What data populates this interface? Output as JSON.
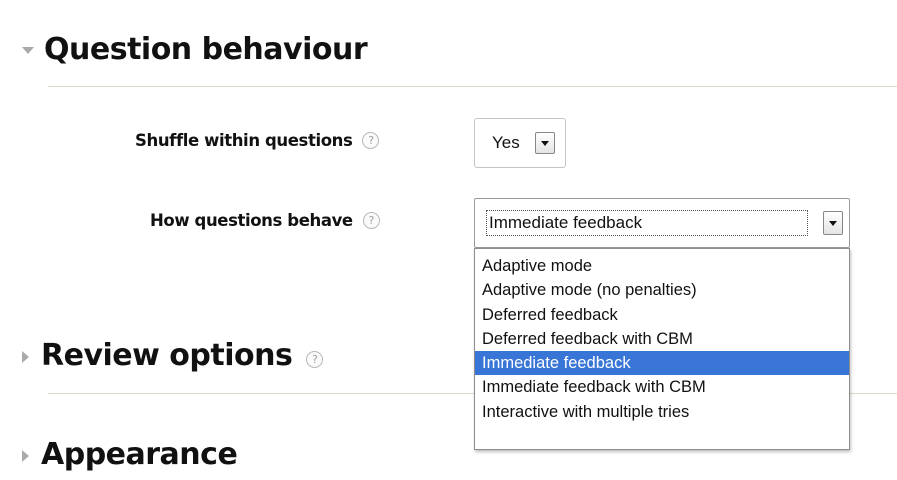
{
  "sections": {
    "question_behaviour": "Question behaviour",
    "review_options": "Review options",
    "appearance": "Appearance"
  },
  "help_glyph": "?",
  "icons": {
    "expanded": "caret-down-icon",
    "collapsed": "caret-right-icon",
    "help": "help-icon",
    "select_arrow": "chevron-down-icon"
  },
  "colors": {
    "selected_option_bg": "#3875d7",
    "selected_option_text": "#ffffff",
    "rule": "#dcdcc4"
  },
  "fields": {
    "shuffle": {
      "label": "Shuffle within questions",
      "value": "Yes"
    },
    "behave": {
      "label": "How questions behave",
      "value": "Immediate feedback",
      "options": [
        "Adaptive mode",
        "Adaptive mode (no penalties)",
        "Deferred feedback",
        "Deferred feedback with CBM",
        "Immediate feedback",
        "Immediate feedback with CBM",
        "Interactive with multiple tries"
      ],
      "selected_index": 4
    }
  }
}
